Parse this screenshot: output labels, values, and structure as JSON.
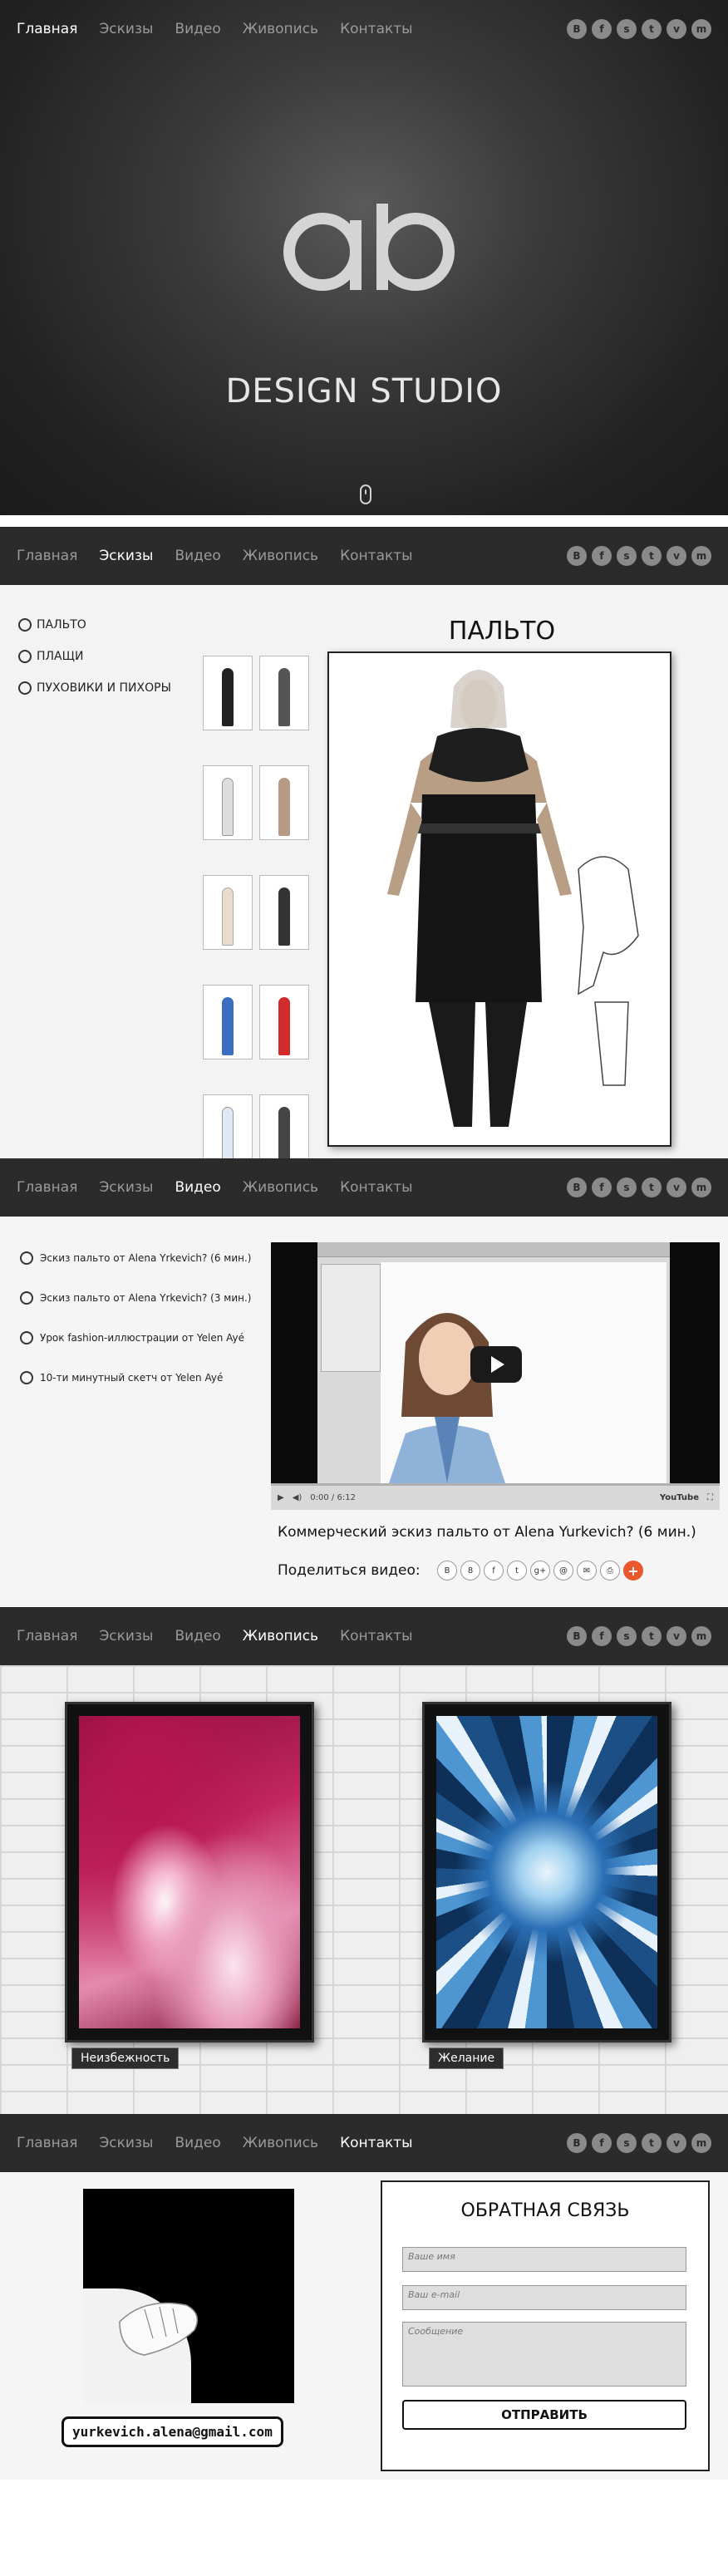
{
  "nav": {
    "items": [
      "Главная",
      "Эскизы",
      "Видео",
      "Живопись",
      "Контакты"
    ]
  },
  "social": [
    "B",
    "f",
    "s",
    "t",
    "v",
    "m"
  ],
  "hero": {
    "logo_icon": "ab-logo-icon",
    "studio_text": "DESIGN STUDIO"
  },
  "sketches": {
    "categories": [
      "ПАЛЬТО",
      "ПЛАЩИ",
      "ПУХОВИКИ И ПИХОРЫ"
    ],
    "title": "ПАЛЬТО"
  },
  "video": {
    "items": [
      "Эскиз пальто от Alena Yrkevich? (6 мин.)",
      "Эскиз пальто от Alena Yrkevich? (3 мин.)",
      "Урок fashion-иллюстрации от Yelen Ayé",
      "10-ти минутный скетч от Yelen Ayé"
    ],
    "time": "0:00 / 6:12",
    "youtube": "YouTube",
    "caption": "Коммерческий эскиз пальто от Alena Yurkevich? (6 мин.)",
    "share_label": "Поделиться видео:",
    "share_icons": [
      "B",
      "8",
      "f",
      "t",
      "g+",
      "@",
      "✉",
      "⎙",
      "+"
    ]
  },
  "paintings": {
    "items": [
      "Неизбежность",
      "Желание"
    ]
  },
  "contacts": {
    "email": "yurkevich.alena@gmail.com",
    "form_title": "ОБРАТНАЯ СВЯЗЬ",
    "name_placeholder": "Ваше имя",
    "email_placeholder": "Ваш e-mail",
    "message_placeholder": "Сообщение",
    "send_label": "ОТПРАВИТЬ"
  },
  "colors": {
    "nav_bg": "#2b2b2b",
    "accent_orange": "#e8582c"
  }
}
